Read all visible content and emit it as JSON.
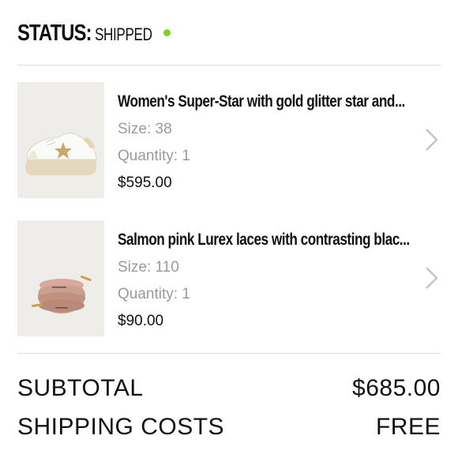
{
  "status": {
    "label": "STATUS:",
    "value": "SHIPPED",
    "indicator_color": "#7ed321"
  },
  "items": [
    {
      "title": "Women's Super-Star with gold glitter star and...",
      "size": "Size: 38",
      "quantity": "Quantity: 1",
      "price": "$595.00",
      "image_icon": "sneaker-image"
    },
    {
      "title": "Salmon pink Lurex laces with contrasting blac...",
      "size": "Size: 110",
      "quantity": "Quantity: 1",
      "price": "$90.00",
      "image_icon": "laces-image"
    }
  ],
  "summary": {
    "subtotal_label": "SUBTOTAL",
    "subtotal_value": "$685.00",
    "shipping_label": "SHIPPING COSTS",
    "shipping_value": "FREE"
  }
}
